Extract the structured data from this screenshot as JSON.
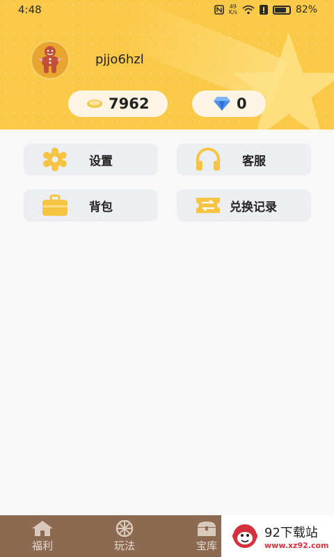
{
  "status_bar": {
    "time": "4:48",
    "net_speed_value": "49",
    "net_speed_unit": "K/s",
    "battery": "82%",
    "battery_level": 0.82
  },
  "profile": {
    "username": "pjjo6hzl",
    "coins": "7962",
    "diamonds": "0"
  },
  "menu": [
    {
      "label": "设置",
      "icon": "gear-icon"
    },
    {
      "label": "客服",
      "icon": "headphones-icon"
    },
    {
      "label": "背包",
      "icon": "briefcase-icon"
    },
    {
      "label": "兑换记录",
      "icon": "exchange-ticket-icon"
    }
  ],
  "tabbar": [
    {
      "label": "福利",
      "icon": "home-icon"
    },
    {
      "label": "玩法",
      "icon": "wheel-icon"
    },
    {
      "label": "宝库",
      "icon": "treasure-chest-icon"
    }
  ],
  "watermark": {
    "title": "92下载站",
    "url": "www.xz92.com"
  },
  "colors": {
    "header": "#fbc948",
    "menu_bg": "#eceef2",
    "icon_yellow": "#f6c443",
    "tabbar": "#8c6a52"
  }
}
